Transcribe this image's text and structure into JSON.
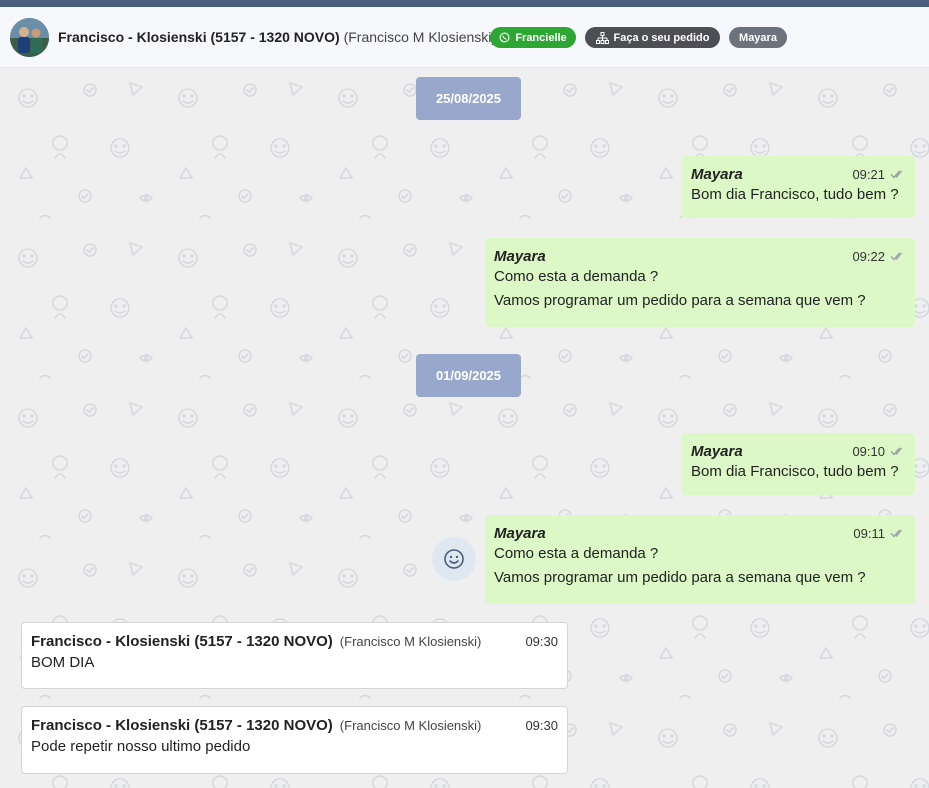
{
  "header": {
    "contact_name": "Francisco - Klosienski (5157 - 1320 NOVO)",
    "contact_subtitle": "(Francisco M Klosienski)",
    "tags": {
      "whatsapp": "Francielle",
      "order": "Faça o seu pedido",
      "agent": "Mayara"
    }
  },
  "colors": {
    "outgoing_bubble": "#dcf8c6",
    "date_chip": "#98a8cc",
    "whatsapp_tag": "#2ea634",
    "topbar": "#4d5f7e"
  },
  "chat": {
    "dates": [
      "25/08/2025",
      "01/09/2025"
    ],
    "outgoing": [
      {
        "sender": "Mayara",
        "time": "09:21",
        "lines": [
          "Bom dia Francisco, tudo bem ?"
        ]
      },
      {
        "sender": "Mayara",
        "time": "09:22",
        "lines": [
          "Como esta a demanda ?",
          "Vamos programar um pedido para a semana que vem ?"
        ]
      },
      {
        "sender": "Mayara",
        "time": "09:10",
        "lines": [
          "Bom dia Francisco, tudo bem ?"
        ]
      },
      {
        "sender": "Mayara",
        "time": "09:11",
        "lines": [
          "Como esta a demanda ?",
          "Vamos programar um pedido para a semana que vem ?"
        ]
      }
    ],
    "incoming": [
      {
        "name": "Francisco - Klosienski (5157 - 1320 NOVO)",
        "subtitle": "(Francisco M Klosienski)",
        "time": "09:30",
        "text": "BOM DIA"
      },
      {
        "name": "Francisco - Klosienski (5157 - 1320 NOVO)",
        "subtitle": "(Francisco M Klosienski)",
        "time": "09:30",
        "text": "Pode repetir nosso ultimo pedido"
      }
    ]
  },
  "icons": {
    "whatsapp_tag": "whatsapp-icon",
    "order_tag": "sitemap-icon",
    "read_receipt": "double-check-icon",
    "emoji_reaction": "smiley-icon"
  }
}
